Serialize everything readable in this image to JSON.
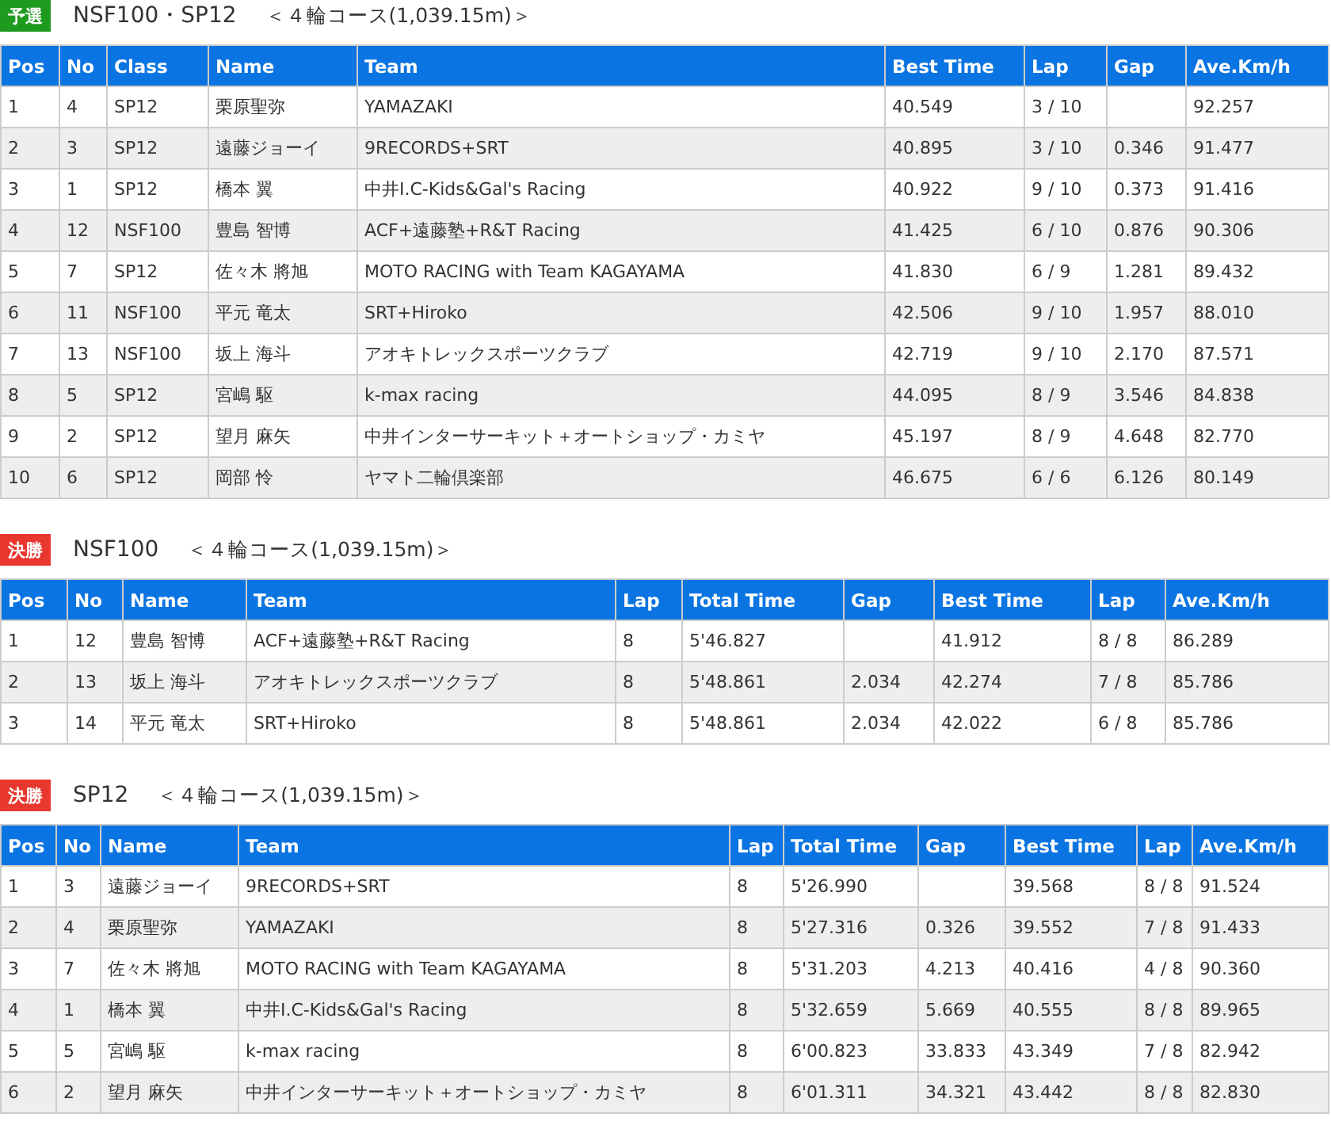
{
  "sections": [
    {
      "badge": {
        "text": "予選",
        "color": "#1e9a1e"
      },
      "title": "NSF100・SP12",
      "course": "＜４輪コース(1,039.15m)＞",
      "columns": [
        "Pos",
        "No",
        "Class",
        "Name",
        "Team",
        "Best Time",
        "Lap",
        "Gap",
        "Ave.Km/h"
      ],
      "rows": [
        [
          "1",
          "4",
          "SP12",
          "栗原聖弥",
          "YAMAZAKI",
          "40.549",
          "3 / 10",
          null,
          "92.257"
        ],
        [
          "2",
          "3",
          "SP12",
          "遠藤ジョーイ",
          "9RECORDS+SRT",
          "40.895",
          "3 / 10",
          "0.346",
          "91.477"
        ],
        [
          "3",
          "1",
          "SP12",
          "橋本 翼",
          "中井I.C-Kids&Gal's Racing",
          "40.922",
          "9 / 10",
          "0.373",
          "91.416"
        ],
        [
          "4",
          "12",
          "NSF100",
          "豊島 智博",
          "ACF+遠藤塾+R&T Racing",
          "41.425",
          "6 / 10",
          "0.876",
          "90.306"
        ],
        [
          "5",
          "7",
          "SP12",
          "佐々木 將旭",
          "MOTO RACING with Team KAGAYAMA",
          "41.830",
          "6 / 9",
          "1.281",
          "89.432"
        ],
        [
          "6",
          "11",
          "NSF100",
          "平元 竜太",
          "SRT+Hiroko",
          "42.506",
          "9 / 10",
          "1.957",
          "88.010"
        ],
        [
          "7",
          "13",
          "NSF100",
          "坂上 海斗",
          "アオキトレックスポーツクラブ",
          "42.719",
          "9 / 10",
          "2.170",
          "87.571"
        ],
        [
          "8",
          "5",
          "SP12",
          "宮嶋 駆",
          "k-max racing",
          "44.095",
          "8 / 9",
          "3.546",
          "84.838"
        ],
        [
          "9",
          "2",
          "SP12",
          "望月 麻矢",
          "中井インターサーキット＋オートショップ・カミヤ",
          "45.197",
          "8 / 9",
          "4.648",
          "82.770"
        ],
        [
          "10",
          "6",
          "SP12",
          "岡部 怜",
          "ヤマト二輪倶楽部",
          "46.675",
          "6 / 6",
          "6.126",
          "80.149"
        ]
      ]
    },
    {
      "badge": {
        "text": "決勝",
        "color": "#e8372f"
      },
      "title": "NSF100",
      "course": "＜４輪コース(1,039.15m)＞",
      "columns": [
        "Pos",
        "No",
        "Name",
        "Team",
        "Lap",
        "Total Time",
        "Gap",
        "Best Time",
        "Lap",
        "Ave.Km/h"
      ],
      "rows": [
        [
          "1",
          "12",
          "豊島 智博",
          "ACF+遠藤塾+R&T Racing",
          "8",
          "5'46.827",
          null,
          "41.912",
          "8 / 8",
          "86.289"
        ],
        [
          "2",
          "13",
          "坂上 海斗",
          "アオキトレックスポーツクラブ",
          "8",
          "5'48.861",
          "2.034",
          "42.274",
          "7 / 8",
          "85.786"
        ],
        [
          "3",
          "14",
          "平元 竜太",
          "SRT+Hiroko",
          "8",
          "5'48.861",
          "2.034",
          "42.022",
          "6 / 8",
          "85.786"
        ]
      ]
    },
    {
      "badge": {
        "text": "決勝",
        "color": "#e8372f"
      },
      "title": "SP12",
      "course": "＜４輪コース(1,039.15m)＞",
      "columns": [
        "Pos",
        "No",
        "Name",
        "Team",
        "Lap",
        "Total Time",
        "Gap",
        "Best Time",
        "Lap",
        "Ave.Km/h"
      ],
      "rows": [
        [
          "1",
          "3",
          "遠藤ジョーイ",
          "9RECORDS+SRT",
          "8",
          "5'26.990",
          null,
          "39.568",
          "8 / 8",
          "91.524"
        ],
        [
          "2",
          "4",
          "栗原聖弥",
          "YAMAZAKI",
          "8",
          "5'27.316",
          "0.326",
          "39.552",
          "7 / 8",
          "91.433"
        ],
        [
          "3",
          "7",
          "佐々木 將旭",
          "MOTO RACING with Team KAGAYAMA",
          "8",
          "5'31.203",
          "4.213",
          "40.416",
          "4 / 8",
          "90.360"
        ],
        [
          "4",
          "1",
          "橋本 翼",
          "中井I.C-Kids&Gal's Racing",
          "8",
          "5'32.659",
          "5.669",
          "40.555",
          "8 / 8",
          "89.965"
        ],
        [
          "5",
          "5",
          "宮嶋 駆",
          "k-max racing",
          "8",
          "6'00.823",
          "33.833",
          "43.349",
          "7 / 8",
          "82.942"
        ],
        [
          "6",
          "2",
          "望月 麻矢",
          "中井インターサーキット＋オートショップ・カミヤ",
          "8",
          "6'01.311",
          "34.321",
          "43.442",
          "8 / 8",
          "82.830"
        ]
      ]
    }
  ]
}
